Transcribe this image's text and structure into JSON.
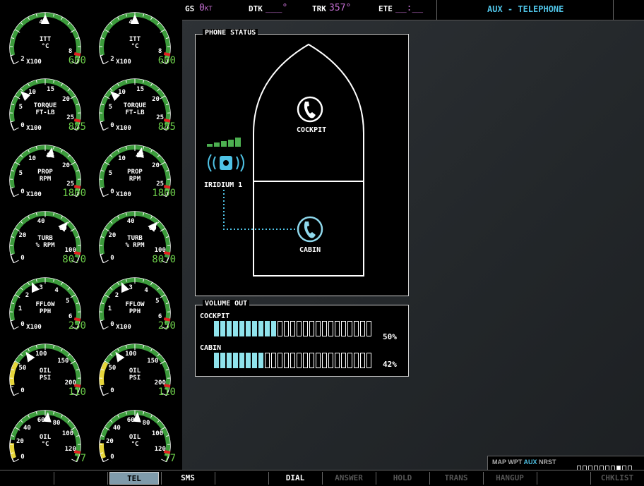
{
  "navbar": {
    "gs_label": "GS",
    "gs_value": "0",
    "gs_unit": "KT",
    "dtk_label": "DTK",
    "dtk_value": "___°",
    "trk_label": "TRK",
    "trk_value": "357°",
    "ete_label": "ETE",
    "ete_value": "__:__",
    "page_title": "AUX - TELEPHONE"
  },
  "engine_gauges": [
    {
      "name": "ITT",
      "line1": "ITT",
      "line2": "°C",
      "mult": "X100",
      "value": "600",
      "ticks": [
        "2",
        "4",
        "8"
      ]
    },
    {
      "name": "ITT",
      "line1": "ITT",
      "line2": "°C",
      "mult": "X100",
      "value": "600",
      "ticks": [
        "2",
        "4",
        "8"
      ]
    },
    {
      "name": "TORQUE",
      "line1": "TORQUE",
      "line2": "FT-LB",
      "mult": "X100",
      "value": "885",
      "ticks": [
        "0",
        "5",
        "10",
        "15",
        "20",
        "25"
      ]
    },
    {
      "name": "TORQUE",
      "line1": "TORQUE",
      "line2": "FT-LB",
      "mult": "X100",
      "value": "885",
      "ticks": [
        "0",
        "5",
        "10",
        "15",
        "20",
        "25"
      ]
    },
    {
      "name": "PROP",
      "line1": "PROP",
      "line2": "RPM",
      "mult": "X100",
      "value": "1800",
      "ticks": [
        "0",
        "5",
        "10",
        "15",
        "20",
        "25"
      ]
    },
    {
      "name": "PROP",
      "line1": "PROP",
      "line2": "RPM",
      "mult": "X100",
      "value": "1800",
      "ticks": [
        "0",
        "5",
        "10",
        "15",
        "20",
        "25"
      ]
    },
    {
      "name": "TURB",
      "line1": "TURB",
      "line2": "% RPM",
      "mult": "",
      "value": "80.0",
      "ticks": [
        "0",
        "20",
        "40",
        "60",
        "100"
      ]
    },
    {
      "name": "TURB",
      "line1": "TURB",
      "line2": "% RPM",
      "mult": "",
      "value": "80.0",
      "ticks": [
        "0",
        "20",
        "40",
        "60",
        "100"
      ]
    },
    {
      "name": "FFLOW",
      "line1": "FFLOW",
      "line2": "PPH",
      "mult": "X100",
      "value": "250",
      "ticks": [
        "0",
        "1",
        "2",
        "3",
        "4",
        "5",
        "6"
      ]
    },
    {
      "name": "FFLOW",
      "line1": "FFLOW",
      "line2": "PPH",
      "mult": "X100",
      "value": "250",
      "ticks": [
        "0",
        "1",
        "2",
        "3",
        "4",
        "5",
        "6"
      ]
    },
    {
      "name": "OIL PSI",
      "line1": "OIL",
      "line2": "PSI",
      "mult": "",
      "value": "110",
      "ticks": [
        "0",
        "50",
        "100",
        "150",
        "200"
      ]
    },
    {
      "name": "OIL PSI",
      "line1": "OIL",
      "line2": "PSI",
      "mult": "",
      "value": "110",
      "ticks": [
        "0",
        "50",
        "100",
        "150",
        "200"
      ]
    },
    {
      "name": "OIL °C",
      "line1": "OIL",
      "line2": "°C",
      "mult": "",
      "value": "77",
      "ticks": [
        "0",
        "20",
        "40",
        "60",
        "80",
        "100",
        "120"
      ]
    },
    {
      "name": "OIL °C",
      "line1": "OIL",
      "line2": "°C",
      "mult": "",
      "value": "77",
      "ticks": [
        "0",
        "20",
        "40",
        "60",
        "80",
        "100",
        "120"
      ]
    }
  ],
  "phone_status": {
    "title": "PHONE STATUS",
    "cockpit_label": "COCKPIT",
    "cabin_label": "CABIN",
    "iridium_label": "IRIDIUM 1",
    "signal_bars_active": 4,
    "signal_bars_total": 5
  },
  "volume_out": {
    "title": "VOLUME OUT",
    "cockpit_label": "COCKPIT",
    "cockpit_percent": "50%",
    "cockpit_level": 0.5,
    "cabin_label": "CABIN",
    "cabin_percent": "42%",
    "cabin_level": 0.42
  },
  "page_group": {
    "items": [
      "MAP",
      "WPT",
      "AUX",
      "NRST"
    ],
    "active": "AUX",
    "page_count": 10,
    "active_page_index": 7
  },
  "softkeys": [
    "",
    "",
    "TEL",
    "SMS",
    "",
    "DIAL",
    "ANSWER",
    "HOLD",
    "TRANS",
    "HANGUP",
    "",
    "CHKLIST"
  ],
  "softkey_states": [
    "off",
    "off",
    "selected",
    "on",
    "off",
    "on",
    "dim",
    "dim",
    "dim",
    "dim",
    "off",
    "dim"
  ],
  "colors": {
    "green_arc": "#3c9c3c",
    "yellow_arc": "#e6d53a",
    "red_mark": "#e02020",
    "value_green": "#6ccd4a",
    "cyan": "#4fc3e6",
    "volume_fill": "#8fe3ec"
  }
}
